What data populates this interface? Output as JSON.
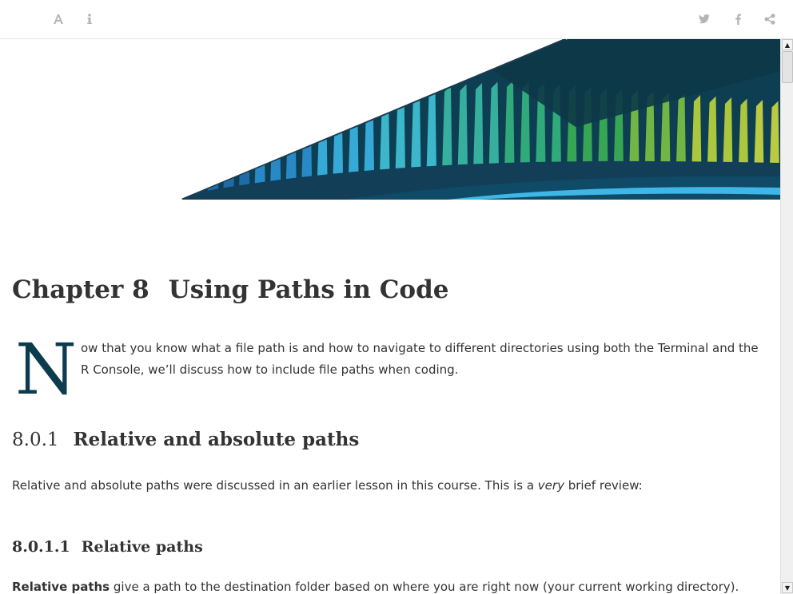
{
  "toolbar": {
    "left_icons": [
      "font-settings-icon",
      "info-icon"
    ],
    "right_icons": [
      "twitter-icon",
      "facebook-icon",
      "share-icon"
    ],
    "icon_color": "#b5b5b5"
  },
  "chapter": {
    "number": "Chapter 8",
    "title": "Using Paths in Code"
  },
  "intro": {
    "dropcap": "N",
    "text": "ow that you know what a file path is and how to navigate to different directories using both the Terminal and the R Console, we’ll discuss how to include file paths when coding."
  },
  "section": {
    "number": "8.0.1",
    "title": "Relative and absolute paths"
  },
  "review": {
    "before": "Relative and absolute paths were discussed in an earlier lesson in this course. This is a ",
    "emphasis": "very",
    "after": " brief review:"
  },
  "subsection": {
    "number": "8.0.1.1",
    "title": "Relative paths"
  },
  "relative_paths": {
    "bold": "Relative paths",
    "rest": " give a path to the destination folder based on where you are right now (your current working directory)."
  },
  "colors": {
    "accent": "#0b3c4d",
    "text": "#333333"
  }
}
